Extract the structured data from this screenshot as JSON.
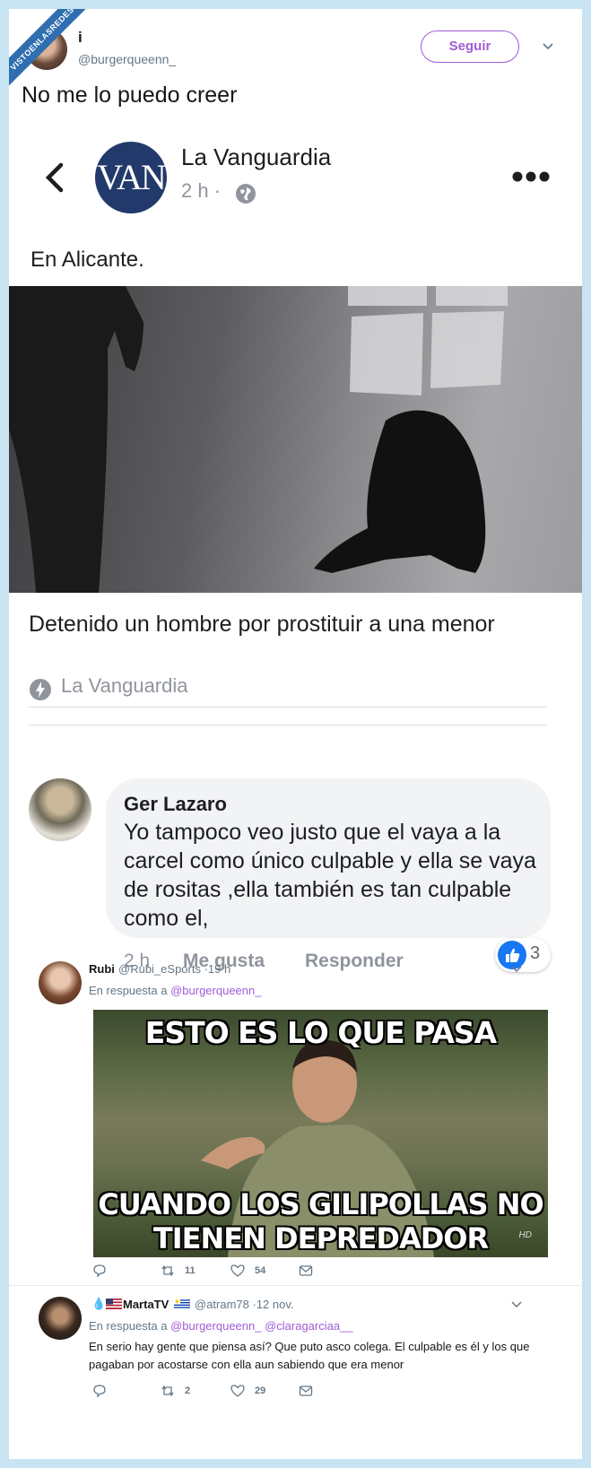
{
  "watermark": "VISTOENLASREDES",
  "tweet": {
    "name": "i",
    "handle": "@burgerqueenn_",
    "follow_label": "Seguir",
    "text": "No me lo puedo creer"
  },
  "fb_post": {
    "page_name": "La Vanguardia",
    "logo_text": "VAN",
    "time": "2 h ·",
    "text": "En Alicante.",
    "article_title": "Detenido un hombre por prostituir a una menor",
    "source": "La Vanguardia"
  },
  "fb_comment": {
    "name": "Ger Lazaro",
    "text": "Yo tampoco veo justo que el vaya a la carcel como único culpable y ella se vaya de rositas ,ella también es tan culpable como el,",
    "time": "2 h",
    "like_label": "Me gusta",
    "reply_label": "Responder",
    "like_count": "3"
  },
  "replies": [
    {
      "name": "Rubi",
      "handle": "@Rubi_eSports ·19 h",
      "in_reply_prefix": "En respuesta a",
      "in_reply_to": "@burgerqueenn_",
      "meme_top": "ESTO ES LO QUE PASA",
      "meme_bottom_1": "CUANDO LOS GILIPOLLAS NO",
      "meme_bottom_2": "TIENEN DEPREDADOR NATURAL",
      "meme_hd": "HD",
      "retweets": "11",
      "likes": "54"
    },
    {
      "name": "MartaTV",
      "handle": "@atram78 ·12 nov.",
      "in_reply_prefix": "En respuesta a",
      "in_reply_to": "@burgerqueenn_ @claragarciaa__",
      "text": "En serio hay gente que piensa así? Que puto asco colega. El culpable es él y los que pagaban por acostarse con ella aun sabiendo que era menor",
      "retweets": "2",
      "likes": "29"
    }
  ],
  "colors": {
    "accent": "#a05cd6",
    "fb_blue": "#1877f2",
    "border": "#c8e4f2"
  }
}
